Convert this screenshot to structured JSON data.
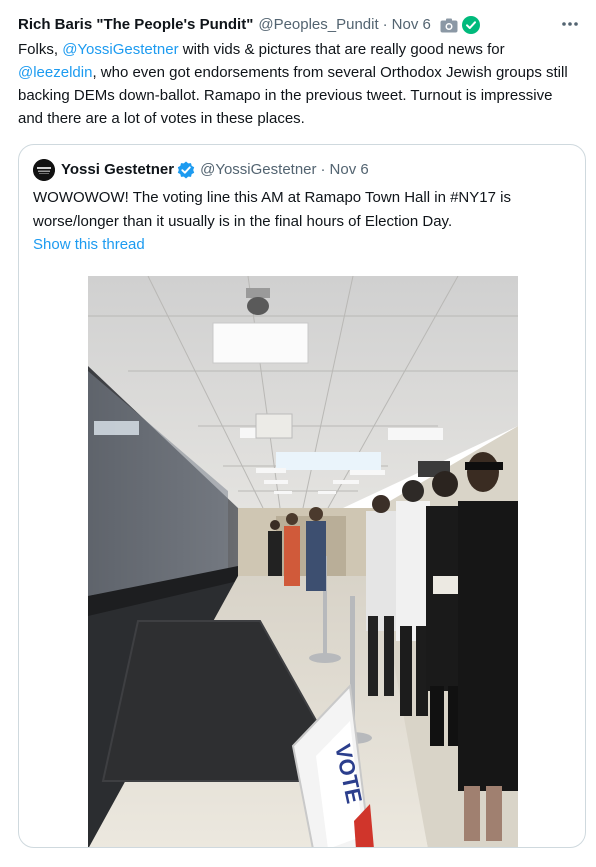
{
  "tweet": {
    "author_name": "Rich Baris \"The People's Pundit\"",
    "handle": "@Peoples_Pundit",
    "separator": "·",
    "date": "Nov 6",
    "more_label": "···",
    "body_segments": [
      "Folks, ",
      "@YossiGestetner",
      " with vids & pictures that are really good news for ",
      "@leezeldin",
      ", who even got endorsements from several Orthodox Jewish groups still backing DEMs down-ballot. Ramapo in the previous tweet. Turnout is impressive and there are a lot of votes in these places."
    ]
  },
  "quote": {
    "author_name": "Yossi Gestetner",
    "handle": "@YossiGestetner",
    "separator": "·",
    "date": "Nov 6",
    "text": "WOWOWOW! The voting line this AM at Ramapo Town Hall in #NY17 is worse/longer than it usually is in the final hours of Election Day.",
    "show_thread": "Show this thread",
    "photo_sign_text": "VOTE"
  },
  "colors": {
    "link": "#1d9bf0",
    "secondary_text": "#536471",
    "border": "#cfd9de",
    "verified_blue": "#1d9bf0",
    "affiliate_green": "#00ba7c"
  }
}
